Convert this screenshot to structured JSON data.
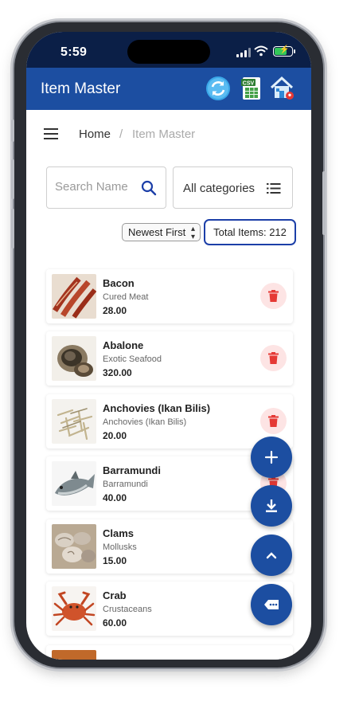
{
  "status_bar": {
    "time": "5:59"
  },
  "app_bar": {
    "title": "Item Master",
    "icons": [
      "refresh-icon",
      "csv-export-icon",
      "home-location-icon"
    ],
    "csv_label": "CSV"
  },
  "breadcrumb": {
    "home": "Home",
    "separator": "/",
    "current": "Item Master"
  },
  "filters": {
    "search_placeholder": "Search Name",
    "category_selected": "All categories",
    "sort_selected": "Newest First",
    "total_items": "Total Items: 212"
  },
  "items": [
    {
      "name": "Bacon",
      "category": "Cured Meat",
      "price": "28.00",
      "thumb_color": "#a3341f"
    },
    {
      "name": "Abalone",
      "category": "Exotic Seafood",
      "price": "320.00",
      "thumb_color": "#6b5a44"
    },
    {
      "name": "Anchovies (Ikan Bilis)",
      "category": "Anchovies (Ikan Bilis)",
      "price": "20.00",
      "thumb_color": "#c9bfa4"
    },
    {
      "name": "Barramundi",
      "category": "Barramundi",
      "price": "40.00",
      "thumb_color": "#7e8a8f"
    },
    {
      "name": "Clams",
      "category": "Mollusks",
      "price": "15.00",
      "thumb_color": "#a89a8a"
    },
    {
      "name": "Crab",
      "category": "Crustaceans",
      "price": "60.00",
      "thumb_color": "#d0532b"
    }
  ],
  "fabs": [
    "add-icon",
    "download-icon",
    "chevron-up-icon",
    "chat-icon"
  ],
  "colors": {
    "primary": "#1c4ea1",
    "status_bar": "#0b1f47",
    "delete_bg": "#fde4e4",
    "delete_icon": "#e53935"
  }
}
